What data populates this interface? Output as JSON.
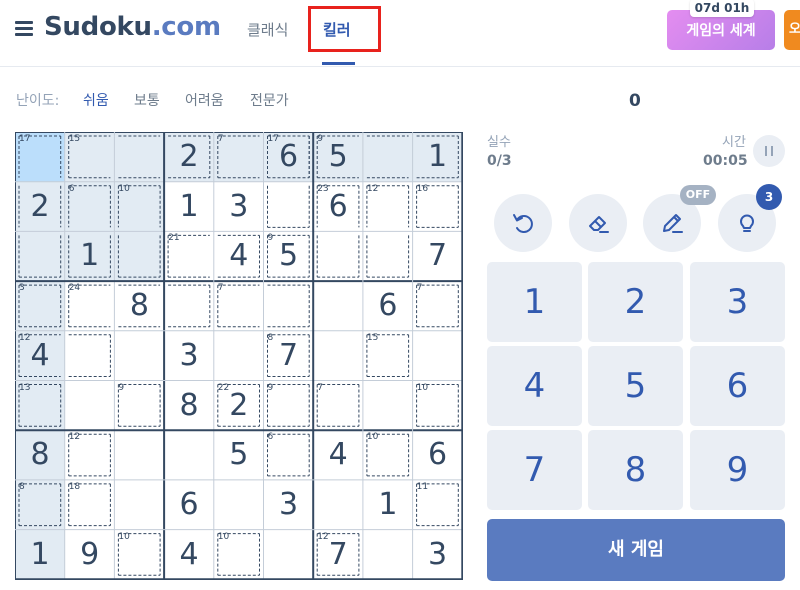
{
  "header": {
    "logo_main": "Sudoku",
    "logo_suffix": ".com",
    "tabs": [
      {
        "label": "클래식"
      },
      {
        "label": "킬러"
      }
    ],
    "world_button": "게임의 세계",
    "world_timer": "07d 01h",
    "orange_button_fragment": "오"
  },
  "difficulty": {
    "label": "난이도:",
    "options": [
      {
        "label": "쉬움"
      },
      {
        "label": "보통"
      },
      {
        "label": "어려움"
      },
      {
        "label": "전문가"
      }
    ],
    "selected": "쉬움"
  },
  "score": "0",
  "stats": {
    "mistakes_label": "실수",
    "mistakes_value": "0/3",
    "time_label": "시간",
    "time_value": "00:05"
  },
  "tools": [
    {
      "name": "undo-icon"
    },
    {
      "name": "eraser-icon"
    },
    {
      "name": "pencil-icon",
      "badge": "OFF"
    },
    {
      "name": "hint-icon",
      "badge": "3"
    }
  ],
  "keypad": [
    "1",
    "2",
    "3",
    "4",
    "5",
    "6",
    "7",
    "8",
    "9"
  ],
  "new_game_label": "새 게임",
  "colors": {
    "accent": "#325aaf",
    "selected_cell": "#bbdefb",
    "highlight_cell": "#e2ebf3",
    "text": "#344861",
    "button_bg": "#eaeef4"
  },
  "board": {
    "selected": [
      0,
      0
    ],
    "values": [
      [
        "",
        "",
        "",
        "2",
        "",
        "6",
        "5",
        "",
        "1"
      ],
      [
        "2",
        "",
        "",
        "1",
        "3",
        "",
        "6",
        "",
        ""
      ],
      [
        "",
        "1",
        "",
        "",
        "4",
        "5",
        "",
        "",
        "7"
      ],
      [
        "",
        "",
        "8",
        "",
        "",
        "",
        "",
        "6",
        ""
      ],
      [
        "4",
        "",
        "",
        "3",
        "",
        "7",
        "",
        "",
        ""
      ],
      [
        "",
        "",
        "",
        "8",
        "2",
        "",
        "",
        "",
        ""
      ],
      [
        "8",
        "",
        "",
        "",
        "5",
        "",
        "4",
        "",
        "6"
      ],
      [
        "",
        "",
        "",
        "6",
        "",
        "3",
        "",
        "1",
        ""
      ],
      [
        "1",
        "9",
        "",
        "4",
        "",
        "",
        "7",
        "",
        "3"
      ]
    ],
    "cages": [
      {
        "sum": "17",
        "cells": [
          [
            0,
            0
          ],
          [
            1,
            0
          ],
          [
            2,
            0
          ]
        ]
      },
      {
        "sum": "15",
        "cells": [
          [
            0,
            1
          ],
          [
            0,
            2
          ],
          [
            0,
            3
          ]
        ]
      },
      {
        "sum": "7",
        "cells": [
          [
            0,
            4
          ],
          [
            0,
            5
          ]
        ]
      },
      {
        "sum": "17",
        "cells": [
          [
            0,
            5
          ],
          [
            1,
            5
          ]
        ]
      },
      {
        "sum": "9",
        "cells": [
          [
            0,
            6
          ],
          [
            0,
            7
          ],
          [
            0,
            8
          ]
        ]
      },
      {
        "sum": "6",
        "cells": [
          [
            1,
            1
          ],
          [
            2,
            1
          ]
        ]
      },
      {
        "sum": "10",
        "cells": [
          [
            1,
            2
          ],
          [
            2,
            2
          ]
        ]
      },
      {
        "sum": "23",
        "cells": [
          [
            1,
            6
          ],
          [
            2,
            6
          ]
        ]
      },
      {
        "sum": "12",
        "cells": [
          [
            1,
            7
          ],
          [
            2,
            7
          ]
        ]
      },
      {
        "sum": "16",
        "cells": [
          [
            1,
            8
          ]
        ]
      },
      {
        "sum": "21",
        "cells": [
          [
            2,
            3
          ],
          [
            2,
            4
          ]
        ]
      },
      {
        "sum": "9",
        "cells": [
          [
            2,
            5
          ]
        ]
      },
      {
        "sum": "3",
        "cells": [
          [
            3,
            0
          ]
        ]
      },
      {
        "sum": "24",
        "cells": [
          [
            3,
            1
          ],
          [
            3,
            2
          ],
          [
            3,
            3
          ]
        ]
      },
      {
        "sum": "7",
        "cells": [
          [
            3,
            4
          ],
          [
            3,
            5
          ]
        ]
      },
      {
        "sum": "7",
        "cells": [
          [
            3,
            8
          ]
        ]
      },
      {
        "sum": "12",
        "cells": [
          [
            4,
            0
          ],
          [
            4,
            1
          ]
        ]
      },
      {
        "sum": "8",
        "cells": [
          [
            4,
            5
          ]
        ]
      },
      {
        "sum": "15",
        "cells": [
          [
            4,
            7
          ]
        ]
      },
      {
        "sum": "13",
        "cells": [
          [
            5,
            0
          ]
        ]
      },
      {
        "sum": "9",
        "cells": [
          [
            5,
            2
          ]
        ]
      },
      {
        "sum": "22",
        "cells": [
          [
            5,
            4
          ]
        ]
      },
      {
        "sum": "9",
        "cells": [
          [
            5,
            5
          ]
        ]
      },
      {
        "sum": "7",
        "cells": [
          [
            5,
            6
          ]
        ]
      },
      {
        "sum": "10",
        "cells": [
          [
            5,
            8
          ]
        ]
      },
      {
        "sum": "12",
        "cells": [
          [
            6,
            1
          ]
        ]
      },
      {
        "sum": "6",
        "cells": [
          [
            6,
            5
          ]
        ]
      },
      {
        "sum": "10",
        "cells": [
          [
            6,
            7
          ]
        ]
      },
      {
        "sum": "8",
        "cells": [
          [
            7,
            0
          ]
        ]
      },
      {
        "sum": "18",
        "cells": [
          [
            7,
            1
          ]
        ]
      },
      {
        "sum": "11",
        "cells": [
          [
            7,
            8
          ]
        ]
      },
      {
        "sum": "10",
        "cells": [
          [
            8,
            2
          ]
        ]
      },
      {
        "sum": "10",
        "cells": [
          [
            8,
            4
          ]
        ]
      },
      {
        "sum": "12",
        "cells": [
          [
            8,
            6
          ]
        ]
      }
    ]
  }
}
